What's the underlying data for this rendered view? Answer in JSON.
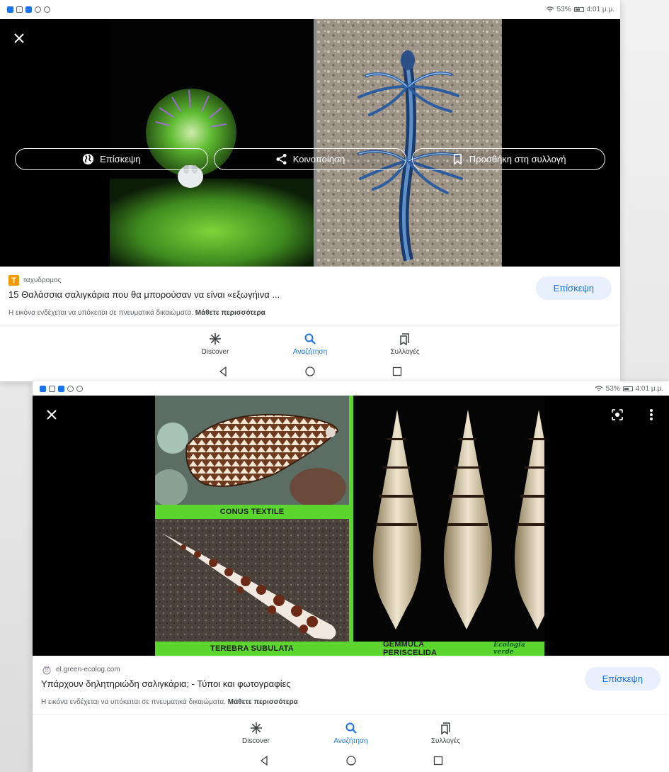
{
  "status_bar": {
    "battery": "53%",
    "time": "4:01 μ.μ."
  },
  "screen1": {
    "chips": [
      {
        "label": "Επίσκεψη",
        "icon": "globe-icon"
      },
      {
        "label": "Κοινοποίηση",
        "icon": "share-icon"
      },
      {
        "label": "Προσθήκη στη συλλογή",
        "icon": "bookmark-icon"
      }
    ],
    "source_name": "ταχυδρομος",
    "source_letter": "T",
    "title": "15 Θαλάσσια σαλιγκάρια που θα μπορούσαν να είναι «εξωγήινα ...",
    "rights_text": "Η εικόνα ενδέχεται να υπόκειται σε πνευματικά δικαιώματα.",
    "learn_more": "Μάθετε περισσότερα",
    "visit_label": "Επίσκεψη"
  },
  "screen2": {
    "labels": {
      "conus": "CONUS TEXTILE",
      "terebra": "TEREBRA SUBULATA",
      "gemmula": "GEMMULA PERISCELIDA",
      "watermark": "Ecologia verde"
    },
    "source_name": "el.green-ecolog.com",
    "title": "Υπάρχουν δηλητηριώδη σαλιγκάρια; - Τύποι και φωτογραφίες",
    "rights_text": "Η εικόνα ενδέχεται να υπόκειται σε πνευματικά δικαιώματα.",
    "learn_more": "Μάθετε περισσότερα",
    "visit_label": "Επίσκεψη"
  },
  "nav": {
    "items": [
      {
        "label": "Discover",
        "icon": "asterisk-icon",
        "active": false
      },
      {
        "label": "Αναζήτηση",
        "icon": "search-icon",
        "active": true
      },
      {
        "label": "Συλλογές",
        "icon": "collections-icon",
        "active": false
      }
    ]
  },
  "colors": {
    "accent": "#1a73e8",
    "visit_bg": "#e8f0fe",
    "label_green": "#5cd62e"
  }
}
